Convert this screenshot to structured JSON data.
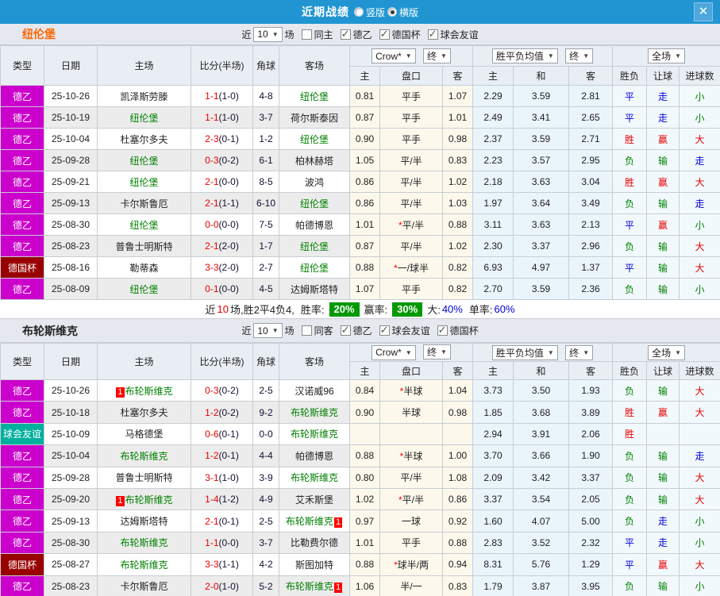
{
  "titlebar": {
    "title": "近期战绩",
    "radios": [
      {
        "label": "竖版",
        "checked": false
      },
      {
        "label": "横版",
        "checked": true
      }
    ],
    "close": "✕"
  },
  "columns": {
    "type": "类型",
    "date": "日期",
    "home": "主场",
    "score": "比分(半场)",
    "corner": "角球",
    "away": "客场",
    "asian_dd": "Crow*",
    "asian_final_dd": "终",
    "asian_home": "主",
    "asian_handicap": "盘口",
    "asian_away": "客",
    "euro_dd": "胜平负均值",
    "euro_final_dd": "终",
    "euro_home": "主",
    "euro_draw": "和",
    "euro_away": "客",
    "scope_dd": "全场",
    "wdl": "胜负",
    "let_goal": "让球",
    "goals": "进球数"
  },
  "colors": {
    "titlebar": "#2095d2",
    "league": "#cc00cc",
    "cup": "#990000",
    "friendly": "#00af9e",
    "featured_team": "#008000",
    "win": "#e60000",
    "draw": "#0000dd",
    "lose": "#008000",
    "summary_pill": "#009900"
  },
  "sections": [
    {
      "team": "纽伦堡",
      "filter": {
        "near": "近",
        "count": "10",
        "unit": "场",
        "checkboxes": [
          {
            "label": "同主",
            "checked": false
          },
          {
            "label": "德乙",
            "checked": true
          },
          {
            "label": "德国杯",
            "checked": true
          },
          {
            "label": "球会友谊",
            "checked": true
          }
        ]
      },
      "rows": [
        {
          "type": "德乙",
          "date": "25-10-26",
          "home": "凯泽斯劳滕",
          "home_badge": "",
          "score": "1-1",
          "half": "(1-0)",
          "corner": "4-8",
          "away": "纽伦堡",
          "away_badge": "",
          "ah": "0.81",
          "hc": "平手",
          "aa": "1.07",
          "eh": "2.29",
          "ed": "3.59",
          "ea": "2.81",
          "wdl": "平",
          "let": "走",
          "goals": "小"
        },
        {
          "type": "德乙",
          "date": "25-10-19",
          "home": "纽伦堡",
          "home_badge": "",
          "score": "1-1",
          "half": "(1-0)",
          "corner": "3-7",
          "away": "荷尔斯泰因",
          "away_badge": "",
          "ah": "0.87",
          "hc": "平手",
          "aa": "1.01",
          "eh": "2.49",
          "ed": "3.41",
          "ea": "2.65",
          "wdl": "平",
          "let": "走",
          "goals": "小"
        },
        {
          "type": "德乙",
          "date": "25-10-04",
          "home": "杜塞尔多夫",
          "home_badge": "",
          "score": "2-3",
          "half": "(0-1)",
          "corner": "1-2",
          "away": "纽伦堡",
          "away_badge": "",
          "ah": "0.90",
          "hc": "平手",
          "aa": "0.98",
          "eh": "2.37",
          "ed": "3.59",
          "ea": "2.71",
          "wdl": "胜",
          "let": "赢",
          "goals": "大"
        },
        {
          "type": "德乙",
          "date": "25-09-28",
          "home": "纽伦堡",
          "home_badge": "",
          "score": "0-3",
          "half": "(0-2)",
          "corner": "6-1",
          "away": "柏林赫塔",
          "away_badge": "",
          "ah": "1.05",
          "hc": "平/半",
          "aa": "0.83",
          "eh": "2.23",
          "ed": "3.57",
          "ea": "2.95",
          "wdl": "负",
          "let": "输",
          "goals": "走"
        },
        {
          "type": "德乙",
          "date": "25-09-21",
          "home": "纽伦堡",
          "home_badge": "",
          "score": "2-1",
          "half": "(0-0)",
          "corner": "8-5",
          "away": "波鸿",
          "away_badge": "",
          "ah": "0.86",
          "hc": "平/半",
          "aa": "1.02",
          "eh": "2.18",
          "ed": "3.63",
          "ea": "3.04",
          "wdl": "胜",
          "let": "赢",
          "goals": "大"
        },
        {
          "type": "德乙",
          "date": "25-09-13",
          "home": "卡尔斯鲁厄",
          "home_badge": "",
          "score": "2-1",
          "half": "(1-1)",
          "corner": "6-10",
          "away": "纽伦堡",
          "away_badge": "",
          "ah": "0.86",
          "hc": "平/半",
          "aa": "1.03",
          "eh": "1.97",
          "ed": "3.64",
          "ea": "3.49",
          "wdl": "负",
          "let": "输",
          "goals": "走"
        },
        {
          "type": "德乙",
          "date": "25-08-30",
          "home": "纽伦堡",
          "home_badge": "",
          "score": "0-0",
          "half": "(0-0)",
          "corner": "7-5",
          "away": "帕德博恩",
          "away_badge": "",
          "ah": "1.01",
          "hc": "*平/半",
          "aa": "0.88",
          "eh": "3.11",
          "ed": "3.63",
          "ea": "2.13",
          "wdl": "平",
          "let": "赢",
          "goals": "小"
        },
        {
          "type": "德乙",
          "date": "25-08-23",
          "home": "普鲁士明斯特",
          "home_badge": "",
          "score": "2-1",
          "half": "(2-0)",
          "corner": "1-7",
          "away": "纽伦堡",
          "away_badge": "",
          "ah": "0.87",
          "hc": "平/半",
          "aa": "1.02",
          "eh": "2.30",
          "ed": "3.37",
          "ea": "2.96",
          "wdl": "负",
          "let": "输",
          "goals": "大"
        },
        {
          "type": "德国杯",
          "date": "25-08-16",
          "home": "勒蒂森",
          "home_badge": "",
          "score": "3-3",
          "half": "(2-0)",
          "corner": "2-7",
          "away": "纽伦堡",
          "away_badge": "",
          "ah": "0.88",
          "hc": "*一/球半",
          "aa": "0.82",
          "eh": "6.93",
          "ed": "4.97",
          "ea": "1.37",
          "wdl": "平",
          "let": "输",
          "goals": "大"
        },
        {
          "type": "德乙",
          "date": "25-08-09",
          "home": "纽伦堡",
          "home_badge": "",
          "score": "0-1",
          "half": "(0-0)",
          "corner": "4-5",
          "away": "达姆斯塔特",
          "away_badge": "",
          "ah": "1.07",
          "hc": "平手",
          "aa": "0.82",
          "eh": "2.70",
          "ed": "3.59",
          "ea": "2.36",
          "wdl": "负",
          "let": "输",
          "goals": "小"
        }
      ],
      "summary": {
        "prefix": "近",
        "count": "10",
        "text": "场,胜2平4负4,",
        "win_label": "胜率:",
        "win": "20%",
        "profit_label": "赢率:",
        "profit": "30%",
        "big_label": "大:",
        "big": "40%",
        "single_label": "单率:",
        "single": "60%"
      }
    },
    {
      "team": "布轮斯维克",
      "filter": {
        "near": "近",
        "count": "10",
        "unit": "场",
        "checkboxes": [
          {
            "label": "同客",
            "checked": false
          },
          {
            "label": "德乙",
            "checked": true
          },
          {
            "label": "球会友谊",
            "checked": true
          },
          {
            "label": "德国杯",
            "checked": true
          }
        ]
      },
      "rows": [
        {
          "type": "德乙",
          "date": "25-10-26",
          "home": "布轮斯维克",
          "home_badge": "1",
          "score": "0-3",
          "half": "(0-2)",
          "corner": "2-5",
          "away": "汉诺威96",
          "away_badge": "",
          "ah": "0.84",
          "hc": "*半球",
          "aa": "1.04",
          "eh": "3.73",
          "ed": "3.50",
          "ea": "1.93",
          "wdl": "负",
          "let": "输",
          "goals": "大"
        },
        {
          "type": "德乙",
          "date": "25-10-18",
          "home": "杜塞尔多夫",
          "home_badge": "",
          "score": "1-2",
          "half": "(0-2)",
          "corner": "9-2",
          "away": "布轮斯维克",
          "away_badge": "",
          "ah": "0.90",
          "hc": "半球",
          "aa": "0.98",
          "eh": "1.85",
          "ed": "3.68",
          "ea": "3.89",
          "wdl": "胜",
          "let": "赢",
          "goals": "大"
        },
        {
          "type": "球会友谊",
          "date": "25-10-09",
          "home": "马格德堡",
          "home_badge": "",
          "score": "0-6",
          "half": "(0-1)",
          "corner": "0-0",
          "away": "布轮斯维克",
          "away_badge": "",
          "ah": "",
          "hc": "",
          "aa": "",
          "eh": "2.94",
          "ed": "3.91",
          "ea": "2.06",
          "wdl": "胜",
          "let": "",
          "goals": ""
        },
        {
          "type": "德乙",
          "date": "25-10-04",
          "home": "布轮斯维克",
          "home_badge": "",
          "score": "1-2",
          "half": "(0-1)",
          "corner": "4-4",
          "away": "帕德博恩",
          "away_badge": "",
          "ah": "0.88",
          "hc": "*半球",
          "aa": "1.00",
          "eh": "3.70",
          "ed": "3.66",
          "ea": "1.90",
          "wdl": "负",
          "let": "输",
          "goals": "走"
        },
        {
          "type": "德乙",
          "date": "25-09-28",
          "home": "普鲁士明斯特",
          "home_badge": "",
          "score": "3-1",
          "half": "(1-0)",
          "corner": "3-9",
          "away": "布轮斯维克",
          "away_badge": "",
          "ah": "0.80",
          "hc": "平/半",
          "aa": "1.08",
          "eh": "2.09",
          "ed": "3.42",
          "ea": "3.37",
          "wdl": "负",
          "let": "输",
          "goals": "大"
        },
        {
          "type": "德乙",
          "date": "25-09-20",
          "home": "布轮斯维克",
          "home_badge": "1",
          "score": "1-4",
          "half": "(1-2)",
          "corner": "4-9",
          "away": "艾禾斯堡",
          "away_badge": "",
          "ah": "1.02",
          "hc": "*平/半",
          "aa": "0.86",
          "eh": "3.37",
          "ed": "3.54",
          "ea": "2.05",
          "wdl": "负",
          "let": "输",
          "goals": "大"
        },
        {
          "type": "德乙",
          "date": "25-09-13",
          "home": "达姆斯塔特",
          "home_badge": "",
          "score": "2-1",
          "half": "(0-1)",
          "corner": "2-5",
          "away": "布轮斯维克",
          "away_badge": "1",
          "ah": "0.97",
          "hc": "一球",
          "aa": "0.92",
          "eh": "1.60",
          "ed": "4.07",
          "ea": "5.00",
          "wdl": "负",
          "let": "走",
          "goals": "小"
        },
        {
          "type": "德乙",
          "date": "25-08-30",
          "home": "布轮斯维克",
          "home_badge": "",
          "score": "1-1",
          "half": "(0-0)",
          "corner": "3-7",
          "away": "比勒费尔德",
          "away_badge": "",
          "ah": "1.01",
          "hc": "平手",
          "aa": "0.88",
          "eh": "2.83",
          "ed": "3.52",
          "ea": "2.32",
          "wdl": "平",
          "let": "走",
          "goals": "小"
        },
        {
          "type": "德国杯",
          "date": "25-08-27",
          "home": "布轮斯维克",
          "home_badge": "",
          "score": "3-3",
          "half": "(1-1)",
          "corner": "4-2",
          "away": "斯图加特",
          "away_badge": "",
          "ah": "0.88",
          "hc": "*球半/两",
          "aa": "0.94",
          "eh": "8.31",
          "ed": "5.76",
          "ea": "1.29",
          "wdl": "平",
          "let": "赢",
          "goals": "大"
        },
        {
          "type": "德乙",
          "date": "25-08-23",
          "home": "卡尔斯鲁厄",
          "home_badge": "",
          "score": "2-0",
          "half": "(1-0)",
          "corner": "5-2",
          "away": "布轮斯维克",
          "away_badge": "1",
          "ah": "1.06",
          "hc": "半/一",
          "aa": "0.83",
          "eh": "1.79",
          "ed": "3.87",
          "ea": "3.95",
          "wdl": "负",
          "let": "输",
          "goals": "小"
        }
      ]
    }
  ]
}
